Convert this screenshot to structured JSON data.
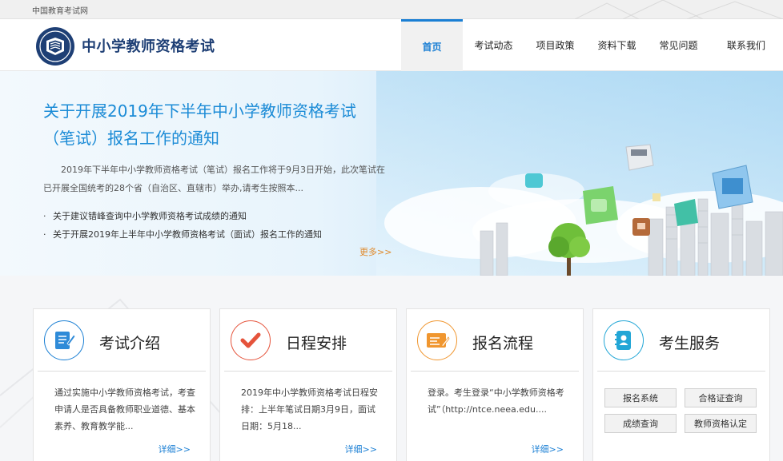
{
  "topbar": {
    "label": "中国教育考试网"
  },
  "header": {
    "site_title": "中小学教师资格考试",
    "logo_icon": "book-shield-logo",
    "nav": [
      {
        "label": "首页",
        "active": true
      },
      {
        "label": "考试动态",
        "active": false
      },
      {
        "label": "项目政策",
        "active": false
      },
      {
        "label": "资料下载",
        "active": false
      },
      {
        "label": "常见问题",
        "active": false
      },
      {
        "label": "联系我们",
        "active": false
      }
    ]
  },
  "banner": {
    "headline": "关于开展2019年下半年中小学教师资格考试（笔试）报名工作的通知",
    "summary": "2019年下半年中小学教师资格考试（笔试）报名工作将于9月3日开始，此次笔试在已开展全国统考的28个省（自治区、直辖市）举办,请考生按照本...",
    "news": [
      "关于建议错峰查询中小学教师资格考试成绩的通知",
      "关于开展2019年上半年中小学教师资格考试（面试）报名工作的通知"
    ],
    "more": "更多>>"
  },
  "cards": [
    {
      "title": "考试介绍",
      "icon": "document-pencil-icon",
      "body": "通过实施中小学教师资格考试，考查申请人是否具备教师职业道德、基本素养、教育教学能...",
      "detail": "详细>>"
    },
    {
      "title": "日程安排",
      "icon": "checkmark-icon",
      "body": "2019年中小学教师资格考试日程安排：上半年笔试日期3月9日，面试日期：5月18...",
      "detail": "详细>>"
    },
    {
      "title": "报名流程",
      "icon": "form-pencil-icon",
      "body": "登录。考生登录“中小学教师资格考试”（http://ntce.neea.edu....",
      "detail": "详细>>"
    },
    {
      "title": "考生服务",
      "icon": "person-card-icon",
      "buttons": [
        "报名系统",
        "合格证查询",
        "成绩查询",
        "教师资格认定"
      ]
    }
  ],
  "colors": {
    "accent_blue": "#1a7fd4",
    "title_navy": "#1e3f75",
    "more_orange": "#e08a2c",
    "check_red": "#e5533b",
    "form_orange": "#f0962f",
    "service_cyan": "#22a6d6"
  }
}
